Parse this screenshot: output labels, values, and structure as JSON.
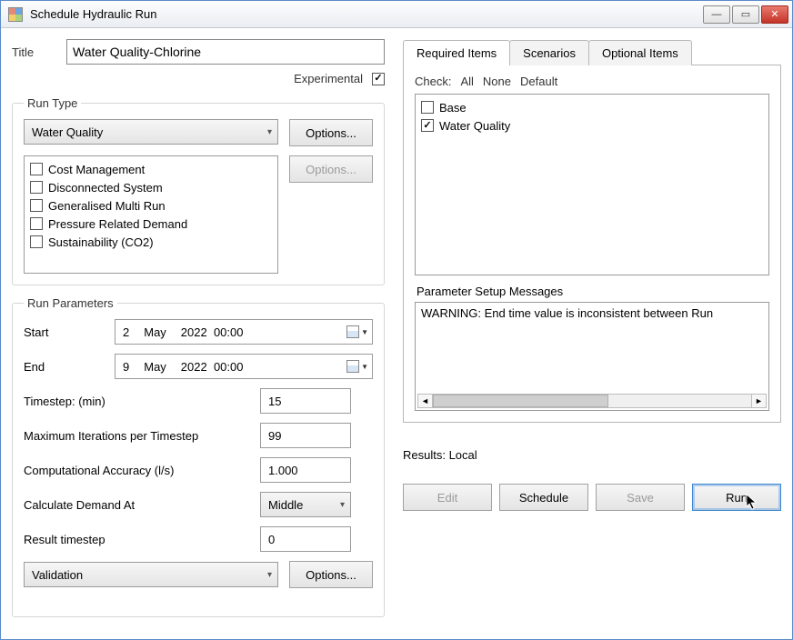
{
  "window": {
    "title": "Schedule Hydraulic Run"
  },
  "title_field": {
    "label": "Title",
    "value": "Water Quality-Chlorine"
  },
  "experimental": {
    "label": "Experimental",
    "checked": true
  },
  "run_type": {
    "legend": "Run Type",
    "dropdown_value": "Water Quality",
    "options_btn": "Options...",
    "options_btn2": "Options...",
    "items": [
      {
        "label": "Cost Management",
        "checked": false
      },
      {
        "label": "Disconnected System",
        "checked": false
      },
      {
        "label": "Generalised Multi Run",
        "checked": false
      },
      {
        "label": "Pressure Related Demand",
        "checked": false
      },
      {
        "label": "Sustainability (CO2)",
        "checked": false
      }
    ]
  },
  "run_params": {
    "legend": "Run Parameters",
    "start_label": "Start",
    "start": {
      "d": "2",
      "m": "May",
      "y": "2022",
      "t": "00:00"
    },
    "end_label": "End",
    "end": {
      "d": "9",
      "m": "May",
      "y": "2022",
      "t": "00:00"
    },
    "timestep_label": "Timestep: (min)",
    "timestep": "15",
    "maxiter_label": "Maximum Iterations per Timestep",
    "maxiter": "99",
    "compacc_label": "Computational Accuracy (l/s)",
    "compacc": "1.000",
    "calcdemand_label": "Calculate Demand At",
    "calcdemand": "Middle",
    "result_ts_label": "Result timestep",
    "result_ts": "0",
    "validation_value": "Validation",
    "options_btn": "Options..."
  },
  "tabs": {
    "items": [
      {
        "label": "Required Items",
        "active": true
      },
      {
        "label": "Scenarios",
        "active": false
      },
      {
        "label": "Optional Items",
        "active": false
      }
    ]
  },
  "check_links": {
    "prefix": "Check:",
    "all": "All",
    "none": "None",
    "default": "Default"
  },
  "scenarios": [
    {
      "label": "Base",
      "checked": false
    },
    {
      "label": "Water Quality",
      "checked": true
    }
  ],
  "psm": {
    "label": "Parameter Setup Messages",
    "msg": "WARNING: End time value is inconsistent between Run"
  },
  "results_label": "Results: Local",
  "actions": {
    "edit": "Edit",
    "schedule": "Schedule",
    "save": "Save",
    "run": "Run"
  }
}
